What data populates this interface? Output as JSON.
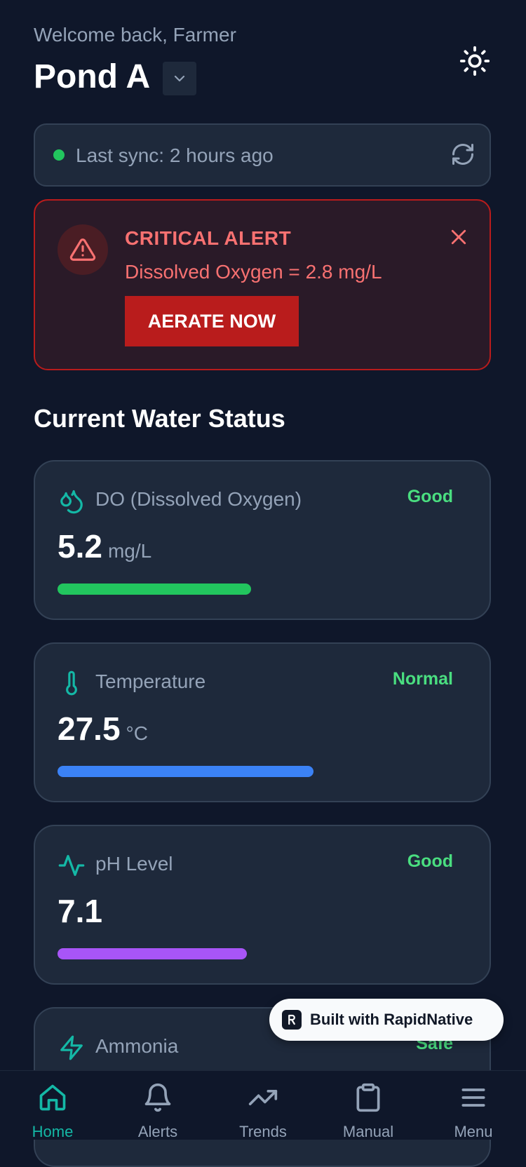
{
  "header": {
    "welcome": "Welcome back, Farmer",
    "pond_name": "Pond A"
  },
  "sync": {
    "text": "Last sync: 2 hours ago",
    "status_color": "#22c55e"
  },
  "alert": {
    "title": "CRITICAL ALERT",
    "message": "Dissolved Oxygen = 2.8 mg/L",
    "action": "AERATE NOW"
  },
  "section_title": "Current Water Status",
  "metrics": [
    {
      "icon": "droplets-icon",
      "name": "DO (Dissolved Oxygen)",
      "value": "5.2",
      "unit": "mg/L",
      "status": "Good",
      "level": 0.47,
      "bar_color": "#22c55e"
    },
    {
      "icon": "thermometer-icon",
      "name": "Temperature",
      "value": "27.5",
      "unit": "°C",
      "status": "Normal",
      "level": 0.62,
      "bar_color": "#3b82f6"
    },
    {
      "icon": "activity-icon",
      "name": "pH Level",
      "value": "7.1",
      "unit": "",
      "status": "Good",
      "level": 0.46,
      "bar_color": "#a855f7"
    },
    {
      "icon": "zap-icon",
      "name": "Ammonia",
      "value": "",
      "unit": "",
      "status": "Safe"
    }
  ],
  "badge": {
    "text": "Built with RapidNative"
  },
  "nav": [
    {
      "icon": "home-icon",
      "label": "Home",
      "active": true
    },
    {
      "icon": "bell-icon",
      "label": "Alerts",
      "active": false
    },
    {
      "icon": "trending-up-icon",
      "label": "Trends",
      "active": false
    },
    {
      "icon": "clipboard-icon",
      "label": "Manual",
      "active": false
    },
    {
      "icon": "menu-icon",
      "label": "Menu",
      "active": false
    }
  ],
  "colors": {
    "background": "#0f172a",
    "card": "#1e293b",
    "accent": "#14b8a6",
    "danger": "#b91c1c",
    "success": "#4ade80"
  }
}
